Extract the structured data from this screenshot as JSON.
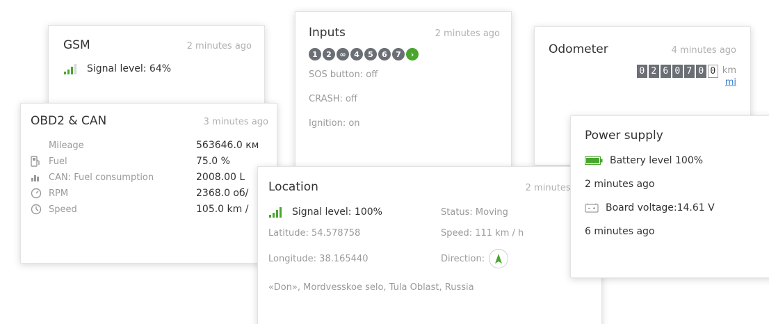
{
  "colors": {
    "accent_green": "#4aa52e",
    "chip_gray": "#6b6f75",
    "link_blue": "#3b7fd1",
    "muted": "#9a9a9a"
  },
  "gsm": {
    "title": "GSM",
    "updated": "2 minutes ago",
    "signal_text": "Signal level: 64%",
    "signal_percent": 64,
    "icon": "signal-bars-icon"
  },
  "obd": {
    "title": "OBD2 & CAN",
    "updated": "3 minutes ago",
    "rows": [
      {
        "icon": "",
        "label": "Mileage",
        "value": "563646.0 км"
      },
      {
        "icon": "fuel-pump-icon",
        "label": "Fuel",
        "value": "75.0 %"
      },
      {
        "icon": "fuel-consumption-icon",
        "label": "CAN: Fuel consumption",
        "value": "2008.00 L"
      },
      {
        "icon": "rpm-gauge-icon",
        "label": "RPM",
        "value": "2368.0 об/"
      },
      {
        "icon": "speedometer-icon",
        "label": "Speed",
        "value": "105.0 km /"
      }
    ]
  },
  "inputs": {
    "title": "Inputs",
    "updated": "2 minutes ago",
    "chips": [
      {
        "label": "1",
        "active": false
      },
      {
        "label": "2",
        "active": false
      },
      {
        "label": "∞",
        "active": false
      },
      {
        "label": "4",
        "active": false
      },
      {
        "label": "5",
        "active": false
      },
      {
        "label": "6",
        "active": false
      },
      {
        "label": "7",
        "active": false
      },
      {
        "label": "›",
        "active": true
      }
    ],
    "statuses": [
      "SOS button: off",
      "CRASH: off",
      "Ignition: on"
    ]
  },
  "odometer": {
    "title": "Odometer",
    "updated": "4 minutes ago",
    "digits": [
      "0",
      "2",
      "6",
      "0",
      "7",
      "0",
      "0"
    ],
    "unit_km": "km",
    "unit_mi": "mi"
  },
  "location": {
    "title": "Location",
    "updated": "2 minutes ago",
    "signal_text": "Signal level: 100%",
    "signal_percent": 100,
    "status": "Status: Moving",
    "latitude": "Latitude: 54.578758",
    "speed": "Speed: 111 km / h",
    "longitude": "Longitude: 38.165440",
    "direction_label": "Direction:",
    "address": "«Don», Mordvesskoe selo, Tula Oblast, Russia"
  },
  "power": {
    "title": "Power supply",
    "battery_text": "Battery level 100%",
    "battery_percent": 100,
    "battery_updated": "2 minutes ago",
    "voltage_text": "Board voltage:14.61 V",
    "voltage_updated": "6 minutes ago"
  }
}
